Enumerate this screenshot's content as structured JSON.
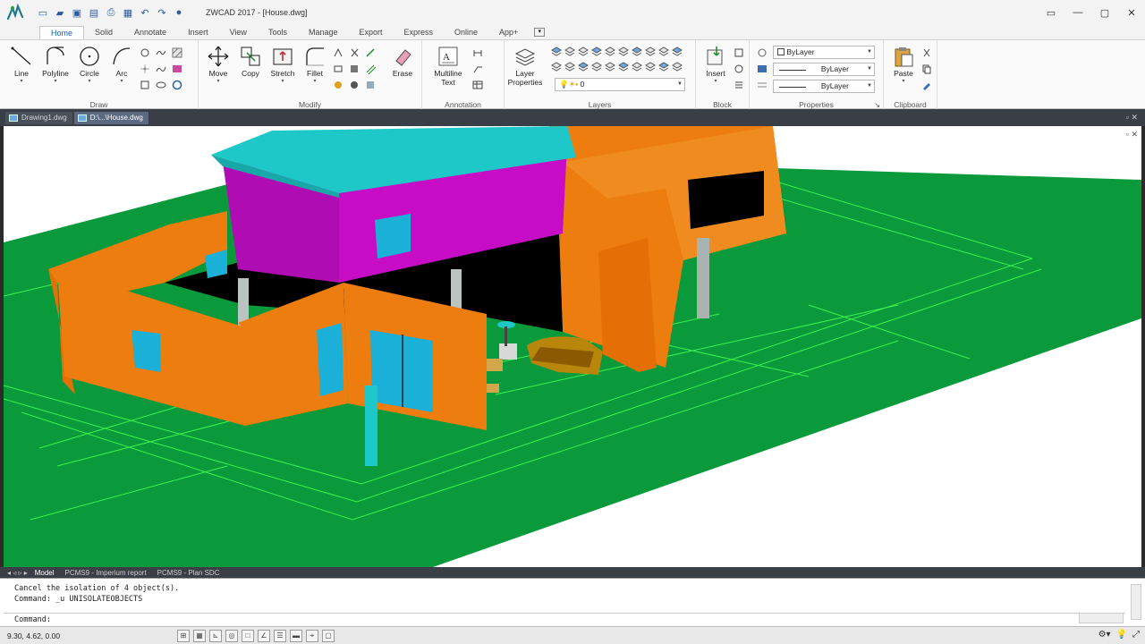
{
  "app": {
    "title": "ZWCAD 2017 - [House.dwg]",
    "logo_icon": "zwcad-logo-icon"
  },
  "quick_access": [
    {
      "name": "new-icon",
      "glyph": "▭"
    },
    {
      "name": "open-icon",
      "glyph": "▰"
    },
    {
      "name": "save-icon",
      "glyph": "▣"
    },
    {
      "name": "saveas-icon",
      "glyph": "▤"
    },
    {
      "name": "print-icon",
      "glyph": "⎙"
    },
    {
      "name": "plot-preview-icon",
      "glyph": "▦"
    },
    {
      "name": "undo-icon",
      "glyph": "↶"
    },
    {
      "name": "redo-icon",
      "glyph": "↷"
    },
    {
      "name": "help-icon",
      "glyph": "●"
    }
  ],
  "window_controls": [
    "▭",
    "—",
    "▢",
    "✕"
  ],
  "ribbon_tabs": [
    "Home",
    "Solid",
    "Annotate",
    "Insert",
    "View",
    "Tools",
    "Manage",
    "Export",
    "Express",
    "Online",
    "App+"
  ],
  "ribbon": {
    "draw": {
      "title": "Draw",
      "line": "Line",
      "polyline": "Polyline",
      "circle": "Circle",
      "arc": "Arc"
    },
    "modify": {
      "title": "Modify",
      "move": "Move",
      "copy": "Copy",
      "stretch": "Stretch",
      "fillet": "Fillet",
      "erase": "Erase"
    },
    "annotation": {
      "title": "Annotation",
      "mtext_line1": "Multiline",
      "mtext_line2": "Text"
    },
    "layers": {
      "title": "Layers",
      "properties_line1": "Layer",
      "properties_line2": "Properties",
      "current_layer": "0"
    },
    "block": {
      "title": "Block",
      "insert": "Insert"
    },
    "properties": {
      "title": "Properties",
      "color": "ByLayer",
      "linetype": "ByLayer",
      "lineweight": "ByLayer"
    },
    "clipboard": {
      "title": "Clipboard",
      "paste": "Paste"
    }
  },
  "doc_tabs": [
    {
      "label": "Drawing1.dwg",
      "active": false
    },
    {
      "label": "D:\\...\\House.dwg",
      "active": true
    }
  ],
  "layout_tabs": [
    "Model",
    "PCMS9 - Imperium report",
    "PCMS9 - Plan SDC"
  ],
  "command": {
    "history_1": "Cancel the isolation of 4 object(s).",
    "history_2": "Command: _u UNISOLATEOBJECTS",
    "prompt": "Command:"
  },
  "status": {
    "coords": "9.30, 4.62, 0.00"
  },
  "colors": {
    "ground": "#0a9a3c",
    "walls": "#ed7d0e",
    "upper_floor": "#c60cc4",
    "roof": "#1fc8c8",
    "glass": "#1ab0d8",
    "wireframe": "#3cf04c"
  }
}
